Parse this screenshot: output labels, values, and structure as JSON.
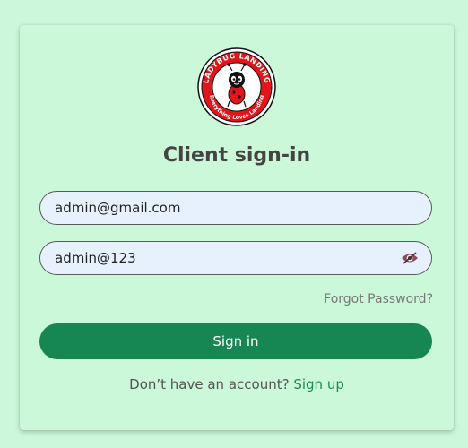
{
  "brand": {
    "logo_name": "ladybug-logo",
    "logo_top_text": "LADYBUG LANDING",
    "logo_bottom_text": "Everything Loves Landing",
    "colors": {
      "red": "#e0161b",
      "black": "#111111"
    }
  },
  "signin_form": {
    "title": "Client sign-in",
    "email_value": "admin@gmail.com",
    "password_value": "admin@123",
    "password_toggle_icon": "eye-hidden-icon",
    "forgot_password": "Forgot Password?",
    "submit_label": "Sign in",
    "signup_prompt": "Don’t have an account?",
    "signup_link": "Sign up"
  },
  "colors": {
    "page_bg": "#ccf7da",
    "button": "#168653",
    "link": "#1b8a5a"
  }
}
